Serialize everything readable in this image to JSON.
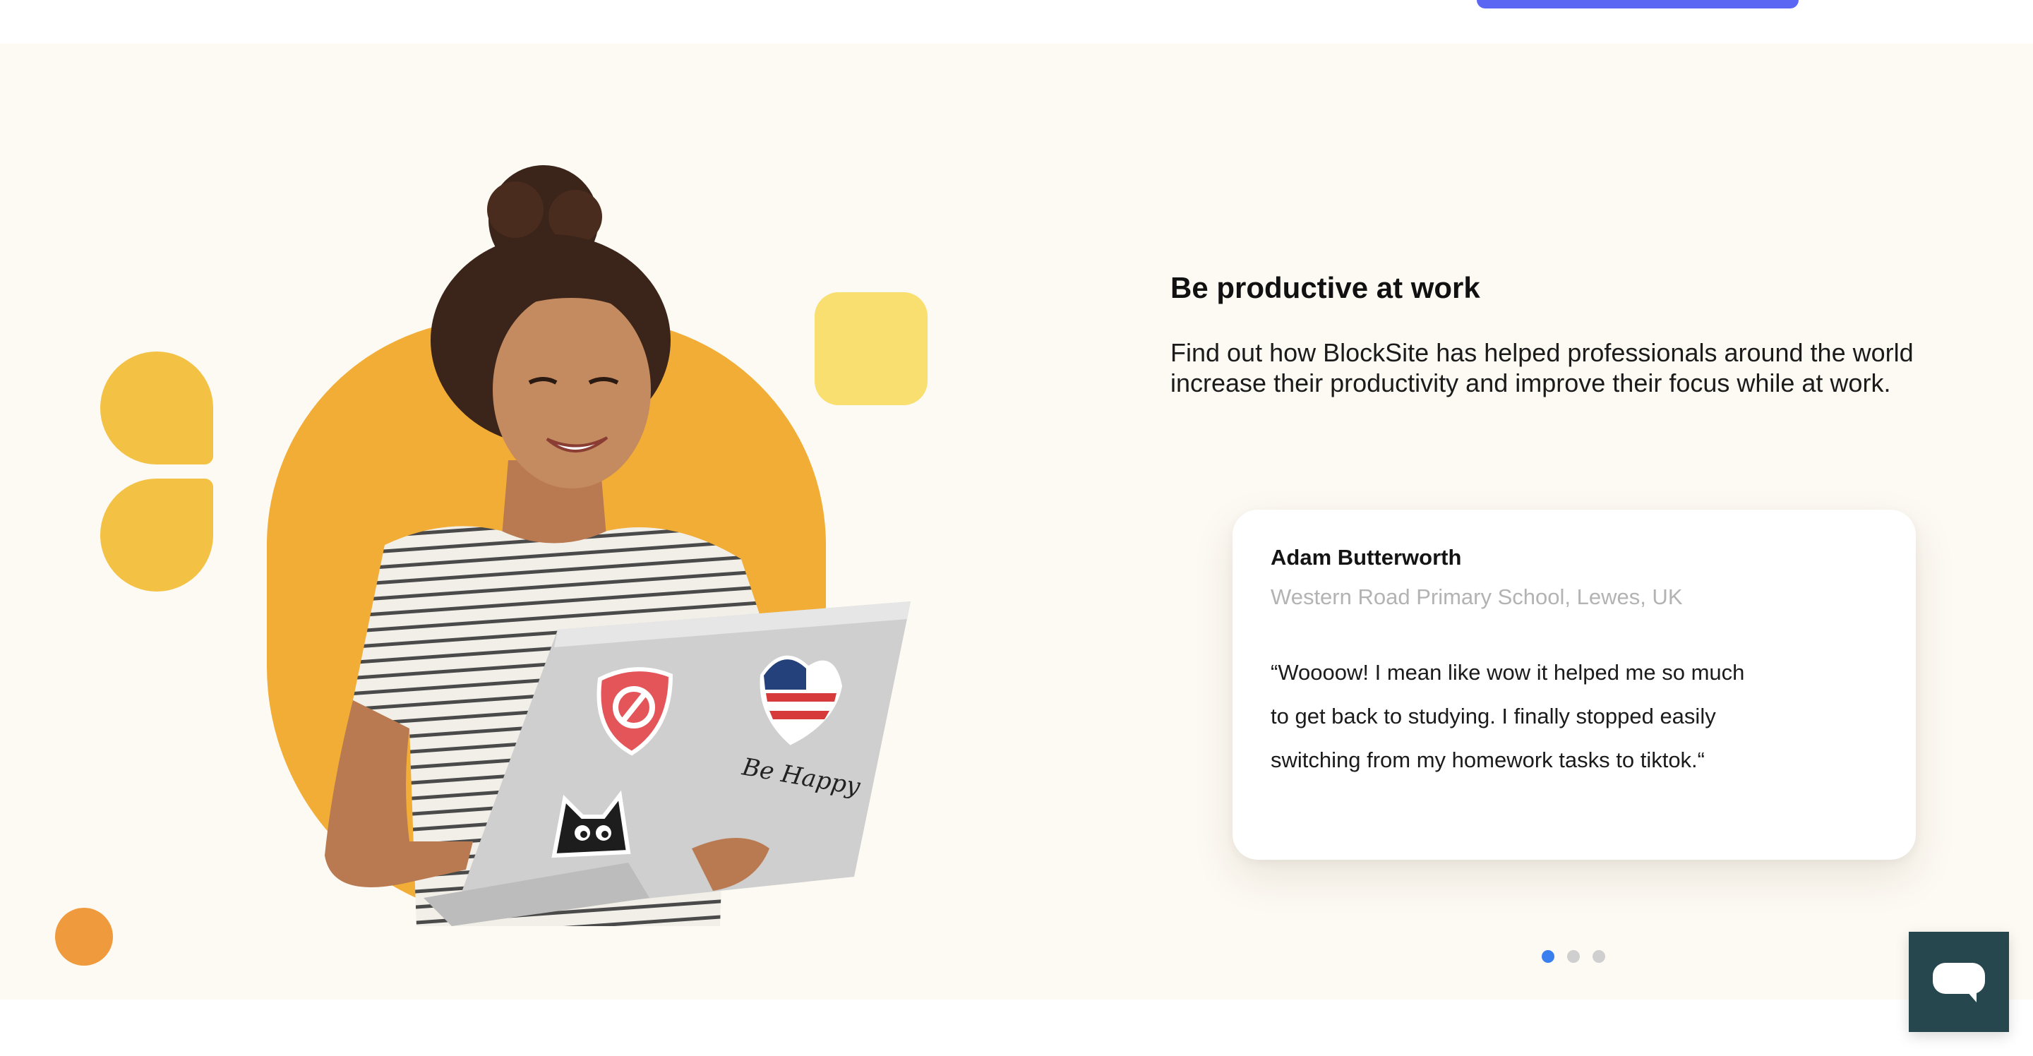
{
  "header": {
    "cta_color": "#5b66f2"
  },
  "feature": {
    "title": "Be productive at work",
    "description": "Find out how BlockSite has helped professionals around the world increase their productivity and improve their focus while at work."
  },
  "testimonial": {
    "name": "Adam Butterworth",
    "role": "Western Road Primary School, Lewes, UK",
    "quote": "“Woooow! I mean like wow it helped me so much to get back to studying. I finally stopped easily switching from my homework tasks to tiktok.“"
  },
  "carousel": {
    "slide_count": 3,
    "active_index": 0,
    "active_color": "#3a7ff0"
  },
  "illustration": {
    "sticker_text": "Be Happy",
    "accent_colors": [
      "#f1ad36",
      "#f3c144",
      "#f8df6f",
      "#f09a3e"
    ]
  },
  "chat_widget": {
    "icon": "chat-bubble-icon",
    "color": "#26474e"
  }
}
